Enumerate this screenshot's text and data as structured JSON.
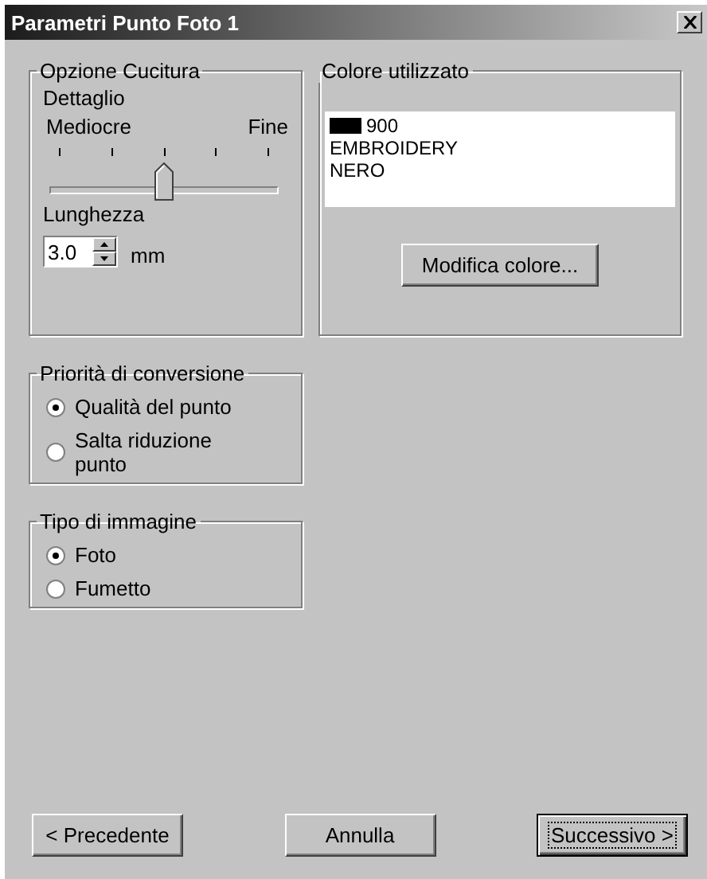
{
  "window": {
    "title": "Parametri Punto Foto 1"
  },
  "stitch_options": {
    "title": "Opzione Cucitura",
    "detail_label": "Dettaglio",
    "min_label": "Mediocre",
    "max_label": "Fine",
    "detail": {
      "level": 0.5
    },
    "length_label": "Lunghezza",
    "length_value": "3.0",
    "length_unit": "mm"
  },
  "color_used": {
    "title": "Colore utilizzato",
    "color": "#000000",
    "lines": [
      "900",
      "EMBROIDERY",
      "NERO"
    ],
    "button": "Modifica colore..."
  },
  "conversion_priority": {
    "title": "Priorità di conversione",
    "options": [
      {
        "label": "Qualità del punto",
        "selected": true
      },
      {
        "label": "Salta riduzione punto",
        "selected": false
      }
    ]
  },
  "image_type": {
    "title": "Tipo di immagine",
    "options": [
      {
        "label": "Foto",
        "selected": true
      },
      {
        "label": "Fumetto",
        "selected": false
      }
    ]
  },
  "buttons": [
    {
      "label": "< Precedente",
      "default": false
    },
    {
      "label": "Annulla",
      "default": false
    },
    {
      "label": "Successivo >",
      "default": true
    }
  ]
}
